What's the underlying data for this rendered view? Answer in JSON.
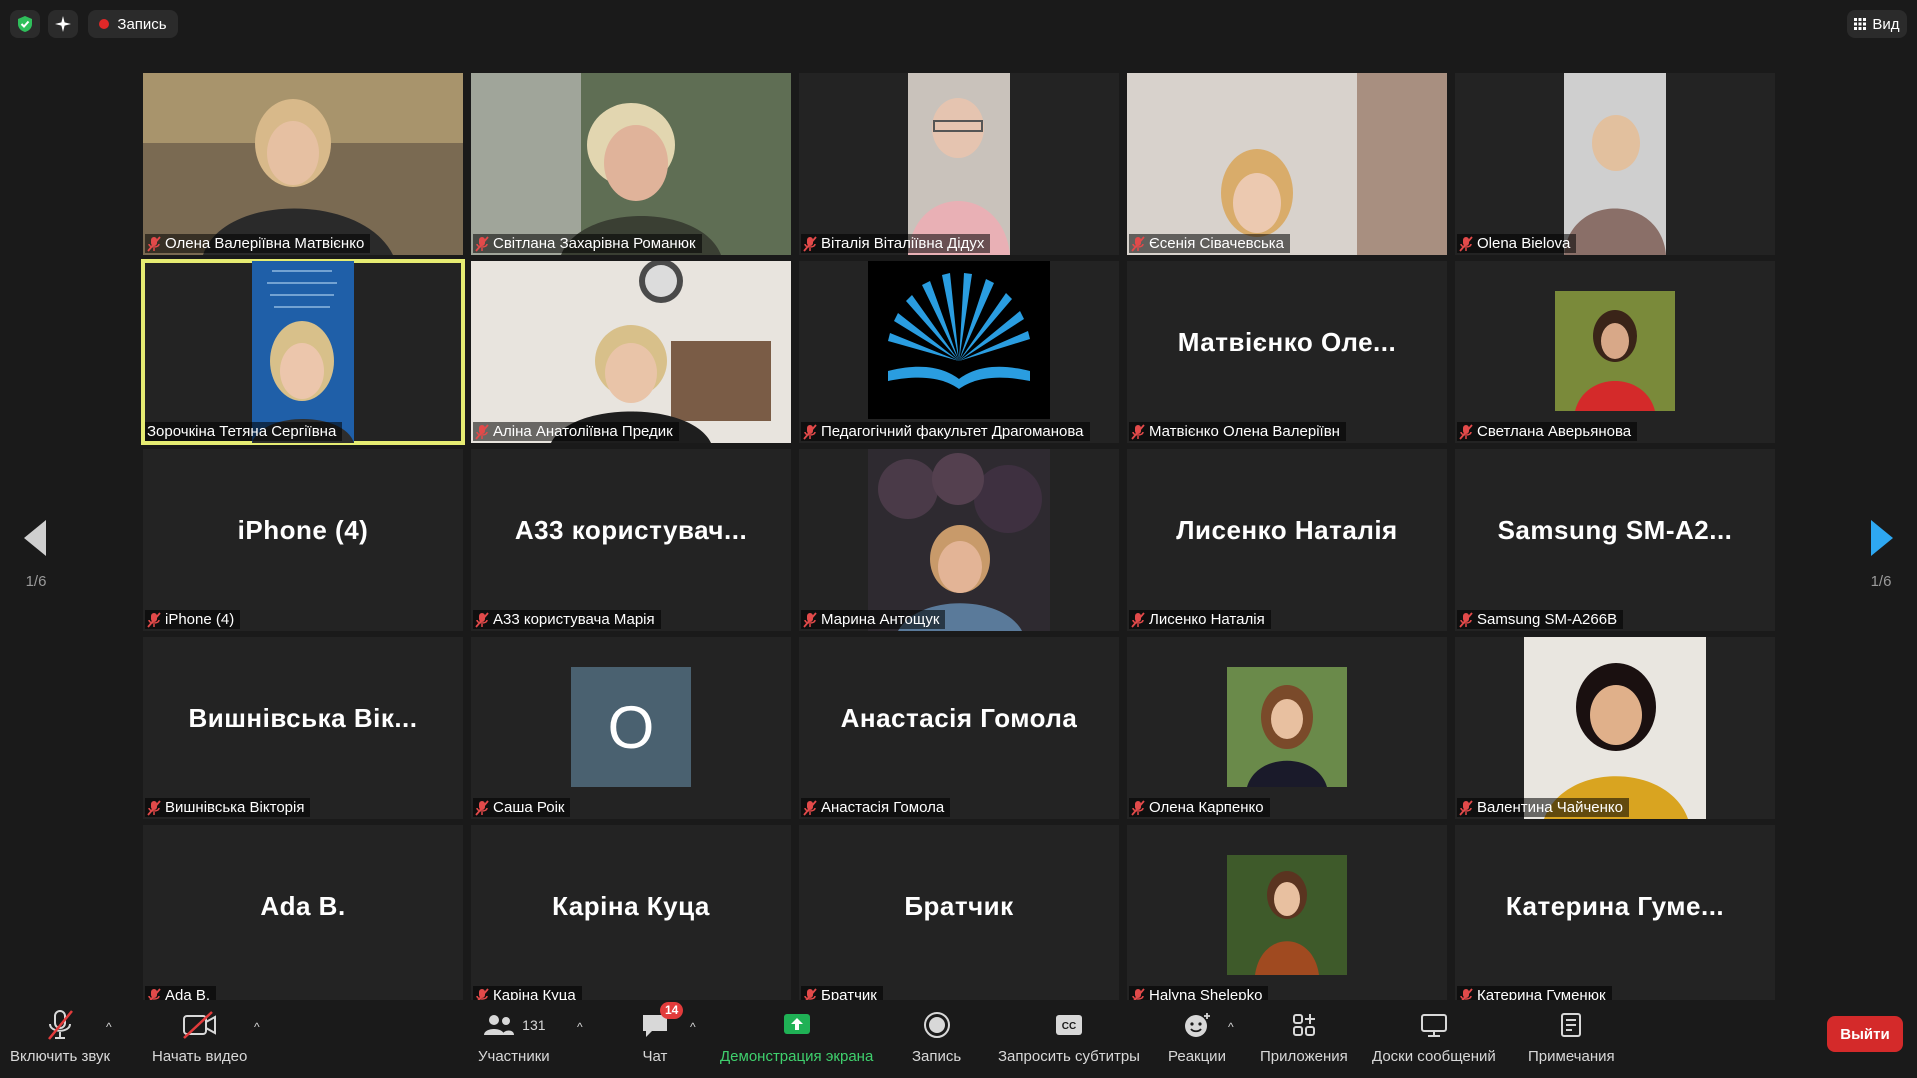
{
  "topbar": {
    "recording_label": "Запись",
    "view_label": "Вид"
  },
  "colors": {
    "active_speaker_border": "#e6ec72",
    "recording_dot": "#e02828",
    "share_green": "#1fb155",
    "leave_red": "#d42a2a"
  },
  "pagination": {
    "left": "1/6",
    "right": "1/6"
  },
  "tiles": [
    {
      "name": "Олена Валеріївна Матвієнко",
      "type": "video"
    },
    {
      "name": "Світлана Захарівна Романюк",
      "type": "video"
    },
    {
      "name": "Віталія Віталіївна Дідух",
      "type": "video"
    },
    {
      "name": "Єсенія Сівачевська",
      "type": "video"
    },
    {
      "name": "Olena Bielova",
      "type": "video"
    },
    {
      "name": "Зорочкіна Тетяна Сергіївна",
      "type": "video",
      "active": true
    },
    {
      "name": "Аліна Анатоліївна Предик",
      "type": "video"
    },
    {
      "name": "Педагогічний факультет Драгоманова",
      "type": "logo"
    },
    {
      "name": "Матвієнко Олена Валеріївн",
      "type": "text",
      "display": "Матвієнко Оле..."
    },
    {
      "name": "Светлана Аверьянова",
      "type": "photo"
    },
    {
      "name": "iPhone (4)",
      "type": "text",
      "display": "iPhone (4)"
    },
    {
      "name": "A33 користувача Марія",
      "type": "text",
      "display": "A33  користувач..."
    },
    {
      "name": "Марина Антощук",
      "type": "photo"
    },
    {
      "name": "Лисенко Наталія",
      "type": "text",
      "display": "Лисенко Наталія"
    },
    {
      "name": "Samsung SM-A266B",
      "type": "text",
      "display": "Samsung  SM-A2..."
    },
    {
      "name": "Вишнівська Вікторія",
      "type": "text",
      "display": "Вишнівська  Вік..."
    },
    {
      "name": "Саша Роік",
      "type": "letter",
      "display": "O"
    },
    {
      "name": "Анастасія Гомола",
      "type": "text",
      "display": "Анастасія Гомола"
    },
    {
      "name": "Олена Карпенко",
      "type": "photo"
    },
    {
      "name": "Валентина Чайченко",
      "type": "photo"
    },
    {
      "name": "Ada B.",
      "type": "text",
      "display": "Ada B."
    },
    {
      "name": "Каріна Куца",
      "type": "text",
      "display": "Каріна Куца"
    },
    {
      "name": "Братчик",
      "type": "text",
      "display": "Братчик"
    },
    {
      "name": "Halyna Shelepko",
      "type": "photo"
    },
    {
      "name": "Катерина Гуменюк",
      "type": "text",
      "display": "Катерина  Гуме..."
    }
  ],
  "toolbar": {
    "unmute": "Включить звук",
    "start_video": "Начать видео",
    "participants": "Участники",
    "participants_count": "131",
    "chat": "Чат",
    "chat_badge": "14",
    "share_screen": "Демонстрация экрана",
    "record": "Запись",
    "captions": "Запросить субтитры",
    "reactions": "Реакции",
    "apps": "Приложения",
    "whiteboards": "Доски сообщений",
    "notes": "Примечания",
    "leave": "Выйти"
  }
}
